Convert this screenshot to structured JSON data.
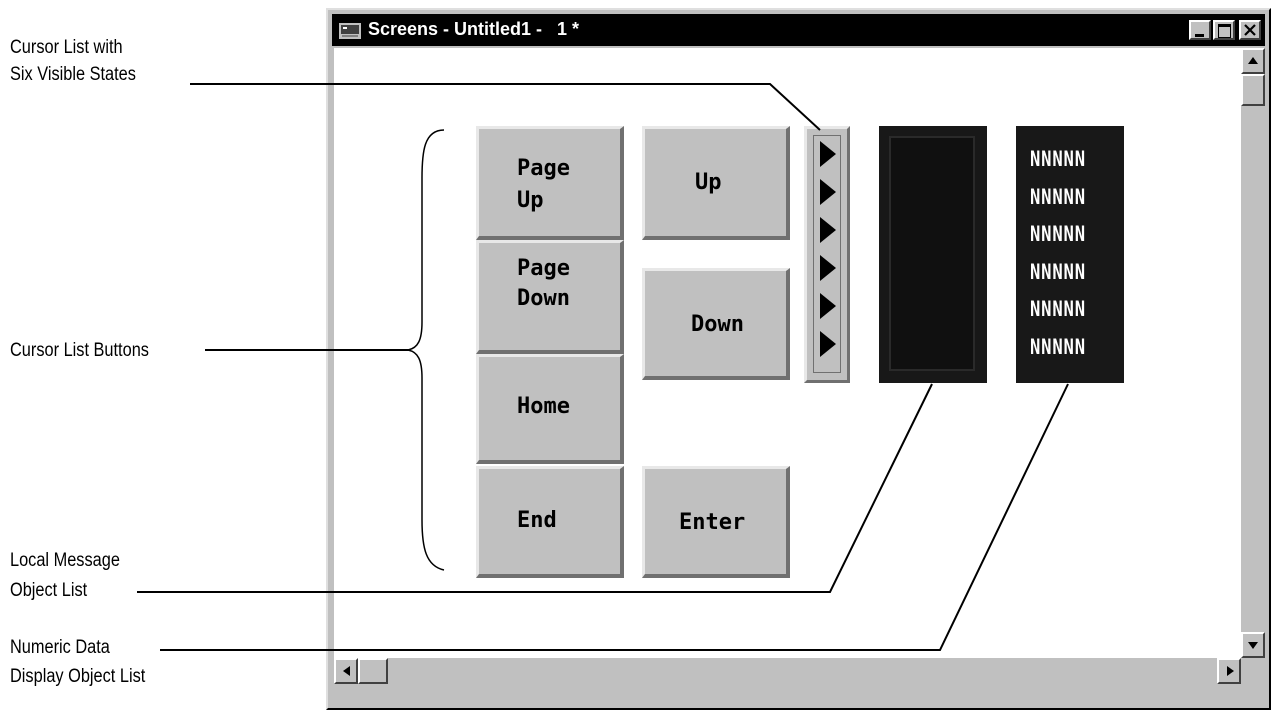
{
  "callouts": {
    "cursor_list_line1": "Cursor List with",
    "cursor_list_line2": "Six Visible States",
    "cursor_list_buttons": "Cursor List Buttons",
    "local_message_line1": "Local Message",
    "local_message_line2": "Object List",
    "numeric_data_line1": "Numeric Data",
    "numeric_data_line2": "Display Object List"
  },
  "window": {
    "title": "Screens - Untitled1 -   1 *",
    "icon": "screen-editor-icon",
    "controls": [
      "minimize-icon",
      "maximize-icon",
      "close-icon"
    ]
  },
  "buttons": {
    "page_up_l1": "Page",
    "page_up_l2": "Up",
    "page_down_l1": "Page",
    "page_down_l2": "Down",
    "home": "Home",
    "end": "End",
    "up": "Up",
    "down": "Down",
    "enter": "Enter"
  },
  "cursor_list": {
    "visible_states": 6,
    "state_icon": "right-triangle-icon"
  },
  "numeric_display": {
    "rows": [
      "NNNNN",
      "NNNNN",
      "NNNNN",
      "NNNNN",
      "NNNNN",
      "NNNNN"
    ]
  },
  "colors": {
    "title_bar": "#000000",
    "window_face": "#c0c0c0",
    "client_background": "#ffffff",
    "display_background": "#181818",
    "display_text": "#ffffff"
  }
}
